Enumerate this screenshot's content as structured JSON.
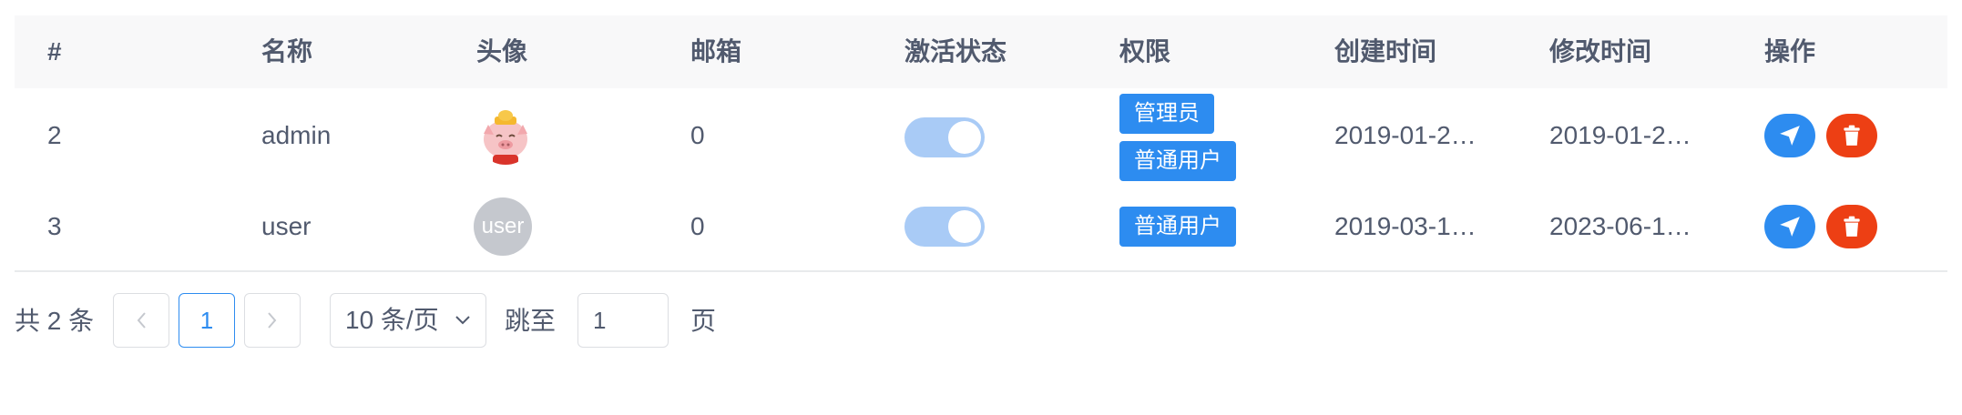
{
  "table": {
    "columns": [
      "#",
      "名称",
      "头像",
      "邮箱",
      "激活状态",
      "权限",
      "创建时间",
      "修改时间",
      "操作"
    ],
    "rows": [
      {
        "id": "2",
        "name": "admin",
        "avatar": "pig-avatar",
        "email": "0",
        "active": true,
        "roles": [
          "管理员",
          "普通用户"
        ],
        "created": "2019-01-2…",
        "modified": "2019-01-2…"
      },
      {
        "id": "3",
        "name": "user",
        "avatar_text": "user",
        "email": "0",
        "active": true,
        "roles": [
          "普通用户"
        ],
        "created": "2019-03-1…",
        "modified": "2023-06-1…"
      }
    ],
    "actions": {
      "edit_icon": "send-arrow-icon",
      "delete_icon": "trash-icon"
    }
  },
  "pagination": {
    "total_text": "共 2 条",
    "current_page": "1",
    "page_size": "10 条/页",
    "jump_label": "跳至",
    "jump_value": "1",
    "page_suffix": "页"
  },
  "colors": {
    "primary": "#2d8cf0",
    "danger": "#ed3f14",
    "switch_on_disabled": "#a9cbf6",
    "header_bg": "#f8f8f9"
  }
}
